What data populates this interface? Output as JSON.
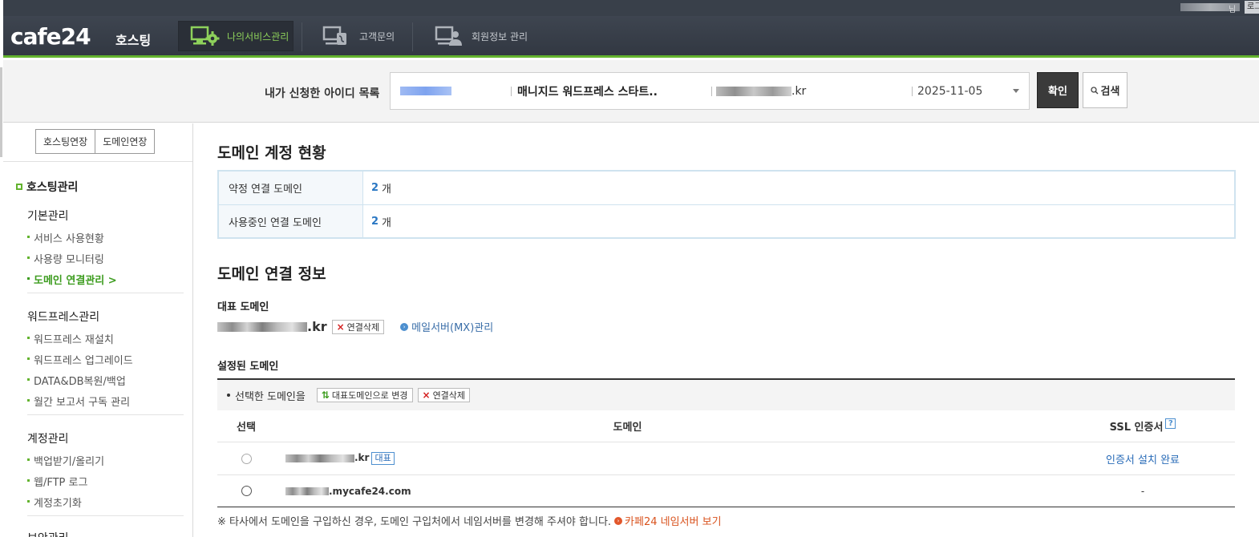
{
  "topbar": {
    "user_suffix": "님",
    "logout_label": "로그"
  },
  "header": {
    "logo": "cafe24",
    "logo_sub": "호스팅",
    "nav": [
      {
        "label": "나의서비스관리",
        "icon": "gear-monitor-icon"
      },
      {
        "label": "고객문의",
        "icon": "monitor-phone-icon"
      },
      {
        "label": "회원정보 관리",
        "icon": "monitor-user-icon"
      }
    ]
  },
  "search": {
    "label": "내가 신청한 아이디 목록",
    "product": "매니지드 워드프레스 스타트..",
    "domain_suffix": ".kr",
    "date": "2025-11-05",
    "confirm_label": "확인",
    "search_label": "검색"
  },
  "sidebar": {
    "tabs": [
      "호스팅연장",
      "도메인연장"
    ],
    "section": "호스팅관리",
    "groups": [
      {
        "title": "기본관리",
        "items": [
          "서비스 사용현황",
          "사용량 모니터링",
          "도메인 연결관리 >"
        ]
      },
      {
        "title": "워드프레스관리",
        "items": [
          "워드프레스 재설치",
          "워드프레스 업그레이드",
          "DATA&DB복원/백업",
          "월간 보고서 구독 관리"
        ]
      },
      {
        "title": "계정관리",
        "items": [
          "백업받기/올리기",
          "웹/FTP 로그",
          "계정초기화"
        ]
      },
      {
        "title": "보안관리",
        "items": []
      }
    ]
  },
  "content": {
    "status_title": "도메인 계정 현황",
    "status_rows": [
      {
        "key": "약정 연결 도메인",
        "count": "2",
        "unit": "개"
      },
      {
        "key": "사용중인 연결 도메인",
        "count": "2",
        "unit": "개"
      }
    ],
    "info_title": "도메인 연결 정보",
    "rep_label": "대표 도메인",
    "rep_domain_suffix": ".kr",
    "remove_label": "연결삭제",
    "mx_label": "메일서버(MX)관리",
    "set_label": "설정된 도메인",
    "toolbar_label": "선택한 도메인을",
    "make_rep_label": "대표도메인으로 변경",
    "headers": {
      "select": "선택",
      "domain": "도메인",
      "ssl": "SSL 인증서"
    },
    "rows": [
      {
        "domain_suffix": ".kr",
        "badge": "대표",
        "ssl": "인증서 설치 완료"
      },
      {
        "domain_suffix": ".mycafe24.com",
        "badge": "",
        "ssl": "-"
      }
    ],
    "note": "※ 타사에서 도메인을 구입하신 경우, 도메인 구입처에서 네임서버를 변경해 주셔야 합니다.",
    "note_link": "카페24 네임서버 보기"
  },
  "colors": {
    "accent_green": "#63b32e",
    "link_blue": "#2a6cb8",
    "note_red": "#d9531e",
    "header_bg": "#363c46"
  }
}
